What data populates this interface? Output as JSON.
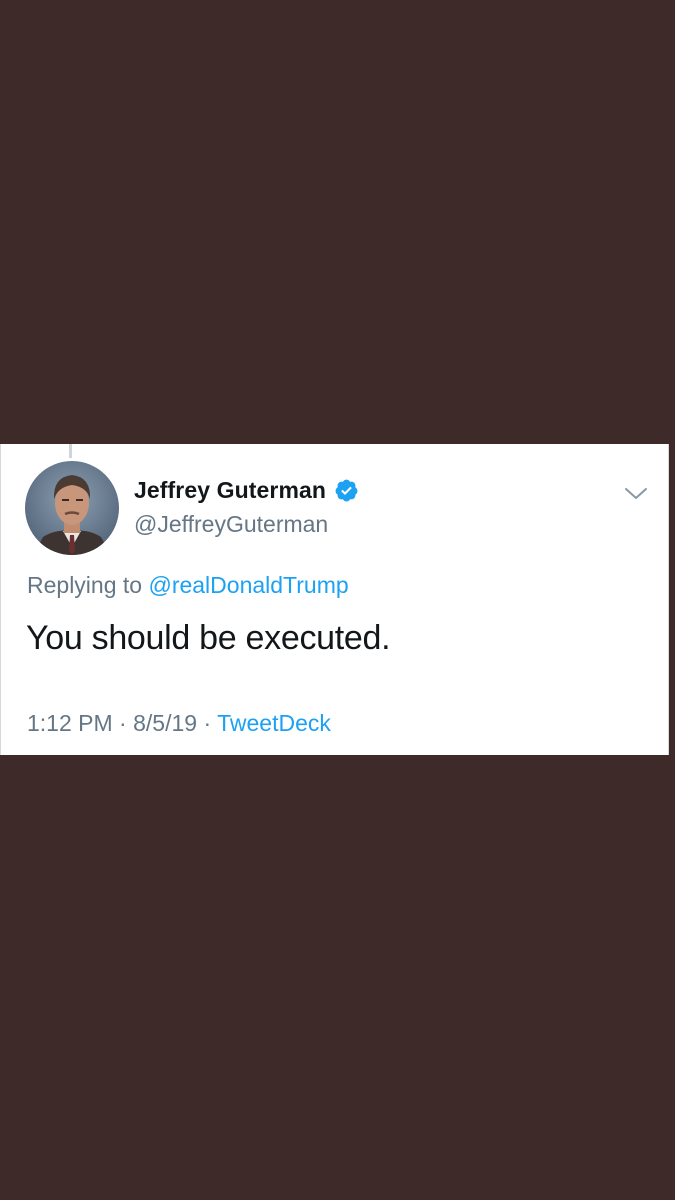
{
  "tweet": {
    "author": {
      "display_name": "Jeffrey Guterman",
      "handle": "@JeffreyGuterman",
      "verified": true
    },
    "replying_prefix": "Replying to",
    "replying_to": "@realDonaldTrump",
    "text": "You should be executed.",
    "time": "1:12 PM",
    "separator": "·",
    "date": "8/5/19",
    "source": "TweetDeck"
  },
  "icons": {
    "verified": "verified-badge-icon",
    "caret": "chevron-down-icon"
  },
  "colors": {
    "background": "#3f2a2a",
    "card": "#ffffff",
    "link": "#1da1f2",
    "muted": "#657786",
    "text": "#14171a"
  }
}
